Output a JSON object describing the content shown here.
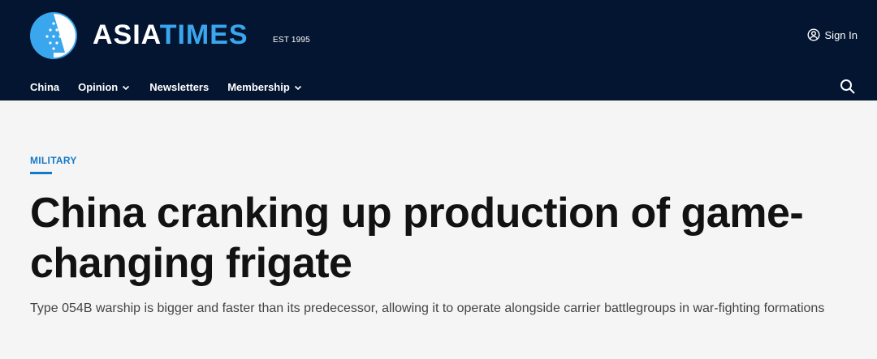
{
  "header": {
    "wordmark_left": "ASIA",
    "wordmark_right": "TIMES",
    "established": "EST 1995",
    "sign_in_label": "Sign In",
    "nav": [
      {
        "label": "China",
        "has_dropdown": false
      },
      {
        "label": "Opinion",
        "has_dropdown": true
      },
      {
        "label": "Newsletters",
        "has_dropdown": false
      },
      {
        "label": "Membership",
        "has_dropdown": true
      }
    ],
    "icons": [
      "user-icon",
      "search-icon",
      "chevron-down-icon"
    ],
    "colors": {
      "bar": "#031530",
      "accent": "#3aa6ee"
    }
  },
  "article": {
    "category": "MILITARY",
    "headline": "China cranking up production of game-changing frigate",
    "dek": "Type 054B warship is bigger and faster than its predecessor, allowing it to operate alongside carrier battlegroups in war-fighting formations",
    "colors": {
      "category": "#1479c8",
      "headline": "#121212",
      "background": "#f5f5f5"
    }
  }
}
